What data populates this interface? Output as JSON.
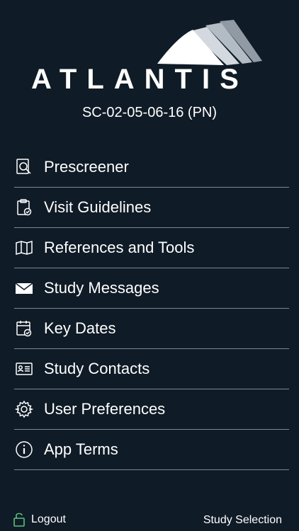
{
  "brand": {
    "name": "ATLANTIS",
    "logo_icon": "atlantis-sail-logo"
  },
  "study": {
    "code": "SC-02-05-06-16 (PN)"
  },
  "menu": {
    "items": [
      {
        "label": "Prescreener",
        "icon": "magnifier-document-icon"
      },
      {
        "label": "Visit Guidelines",
        "icon": "clipboard-check-icon"
      },
      {
        "label": "References and Tools",
        "icon": "open-book-icon"
      },
      {
        "label": "Study Messages",
        "icon": "envelope-icon"
      },
      {
        "label": "Key Dates",
        "icon": "calendar-check-icon"
      },
      {
        "label": "Study Contacts",
        "icon": "contact-card-icon"
      },
      {
        "label": "User Preferences",
        "icon": "gear-icon"
      },
      {
        "label": "App Terms",
        "icon": "info-icon"
      }
    ]
  },
  "footer": {
    "logout_label": "Logout",
    "logout_icon": "unlock-icon",
    "study_selection_label": "Study Selection",
    "accent_color": "#5cc27a"
  },
  "colors": {
    "background": "#0f1b26",
    "divider": "#7c8893",
    "text": "#ffffff"
  }
}
